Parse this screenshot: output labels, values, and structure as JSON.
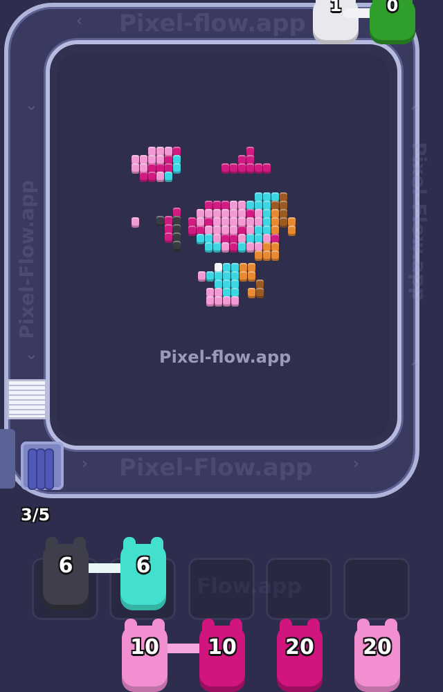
{
  "watermark": {
    "center": "Pixel-flow.app",
    "track_top": "Pixel-flow.app",
    "track_bottom": "Pixel-Flow.app",
    "track_left": "Pixel-Flow.app",
    "track_right": "Pixel-Flow.app",
    "slots": "Flow.app"
  },
  "queue_counter": "3/5",
  "top_shooters": [
    {
      "color": "#e8e8ee",
      "count": "1"
    },
    {
      "color": "#2f9e2a",
      "count": "0"
    }
  ],
  "slot_shooters": [
    {
      "color": "#3e3f4a",
      "count": "6"
    },
    {
      "color": "#43e0cf",
      "count": "6"
    }
  ],
  "waiting_shooters": [
    {
      "color": "#f28fd0",
      "count": "10"
    },
    {
      "color": "#d0157f",
      "count": "10"
    },
    {
      "color": "#d0157f",
      "count": "20"
    },
    {
      "color": "#f28fd0",
      "count": "20"
    }
  ],
  "palette": {
    "pink": "#f29ad3",
    "magenta": "#d01c82",
    "cyan": "#3ed6e2",
    "white": "#f4f4f8",
    "black": "#3a3a44",
    "orange": "#e88a34",
    "brown": "#9a5a24"
  }
}
